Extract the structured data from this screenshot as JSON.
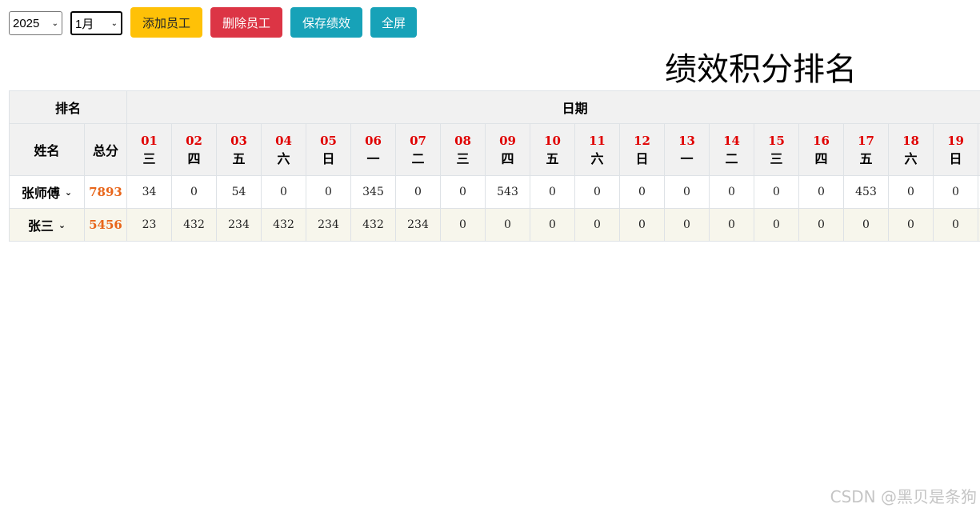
{
  "toolbar": {
    "year": "2025",
    "month": "1月",
    "add_label": "添加员工",
    "delete_label": "删除员工",
    "save_label": "保存绩效",
    "fullscreen_label": "全屏"
  },
  "colors": {
    "add_button": "#ffc107",
    "delete_button": "#dc3545",
    "save_button": "#17a2b8",
    "fullscreen_button": "#17a2b8",
    "day_number": "#e00000",
    "total_score": "#e8661b",
    "header_bg": "#f1f1f1",
    "alt_row_bg": "#f7f6ec"
  },
  "page_title": "绩效积分排名",
  "table": {
    "rank_header": "排名",
    "date_header": "日期",
    "name_header": "姓名",
    "total_header": "总分",
    "days": [
      {
        "num": "01",
        "weekday": "三"
      },
      {
        "num": "02",
        "weekday": "四"
      },
      {
        "num": "03",
        "weekday": "五"
      },
      {
        "num": "04",
        "weekday": "六"
      },
      {
        "num": "05",
        "weekday": "日"
      },
      {
        "num": "06",
        "weekday": "一"
      },
      {
        "num": "07",
        "weekday": "二"
      },
      {
        "num": "08",
        "weekday": "三"
      },
      {
        "num": "09",
        "weekday": "四"
      },
      {
        "num": "10",
        "weekday": "五"
      },
      {
        "num": "11",
        "weekday": "六"
      },
      {
        "num": "12",
        "weekday": "日"
      },
      {
        "num": "13",
        "weekday": "一"
      },
      {
        "num": "14",
        "weekday": "二"
      },
      {
        "num": "15",
        "weekday": "三"
      },
      {
        "num": "16",
        "weekday": "四"
      },
      {
        "num": "17",
        "weekday": "五"
      },
      {
        "num": "18",
        "weekday": "六"
      },
      {
        "num": "19",
        "weekday": "日"
      }
    ],
    "rows": [
      {
        "name": "张师傅",
        "total": "7893",
        "scores": [
          "34",
          "0",
          "54",
          "0",
          "0",
          "345",
          "0",
          "0",
          "543",
          "0",
          "0",
          "0",
          "0",
          "0",
          "0",
          "0",
          "453",
          "0",
          "0"
        ]
      },
      {
        "name": "张三",
        "total": "5456",
        "scores": [
          "23",
          "432",
          "234",
          "432",
          "234",
          "432",
          "234",
          "0",
          "0",
          "0",
          "0",
          "0",
          "0",
          "0",
          "0",
          "0",
          "0",
          "0",
          "0"
        ]
      }
    ]
  },
  "watermark": "CSDN @黑贝是条狗"
}
